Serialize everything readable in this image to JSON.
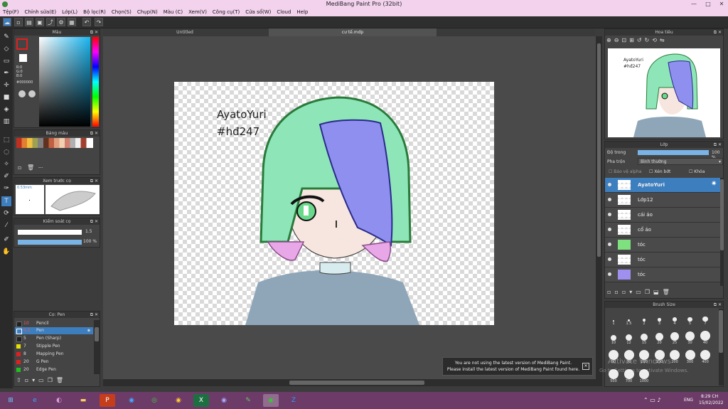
{
  "window": {
    "title": "MediBang Paint Pro (32bit)"
  },
  "menu": [
    "Tệp(F)",
    "Chỉnh sửa(E)",
    "Lớp(L)",
    "Bộ lọc(R)",
    "Chọn(S)",
    "Chụp(N)",
    "Màu (C)",
    "Xem(V)",
    "Công cụ(T)",
    "Cửa sổ(W)",
    "Cloud",
    "Help"
  ],
  "tabs": [
    "Untitled",
    "cư tế.mdp"
  ],
  "color_panel": {
    "title": "Màu",
    "r": "R:0",
    "g": "G:0",
    "b": "B:0",
    "hex": "#000000",
    "fg": "#000000"
  },
  "palette_panel": {
    "title": "Bảng màu",
    "more": "---"
  },
  "brush_preview": {
    "title": "Xem trước cọ",
    "size": "0.53mm"
  },
  "brush_control": {
    "title": "Kiểm soát cọ",
    "size_val": "1.5",
    "opacity_val": "100 %",
    "opacity": 1.0
  },
  "brush_list": {
    "title": "Cọ: Pen",
    "items": [
      {
        "num": "10",
        "name": "Pencil",
        "color": "#222222"
      },
      {
        "num": "0.5",
        "name": "Pen",
        "color": "#3d7ebf"
      },
      {
        "num": "5",
        "name": "Pen (Sharp)",
        "color": "#222222"
      },
      {
        "num": "7",
        "name": "Stipple Pen",
        "color": "#e8e000"
      },
      {
        "num": "8",
        "name": "Mapping Pen",
        "color": "#e02020"
      },
      {
        "num": "20",
        "name": "G Pen",
        "color": "#e02020"
      },
      {
        "num": "20",
        "name": "Edge Pen",
        "color": "#20c020"
      }
    ]
  },
  "canvas": {
    "line1": "AyatoYuri",
    "line2": "#hđ247"
  },
  "navigator": {
    "title": "Hoa tiêu",
    "line1": "AyatoYuri",
    "line2": "#hđ247"
  },
  "layer_panel": {
    "title": "Lớp",
    "opacity_label": "Độ trong",
    "opacity_val": "100 %",
    "opacity": 1.0,
    "blend_label": "Pha trộn",
    "blend_val": "Bình thường",
    "protect_alpha": "Bảo vệ alpha",
    "clip": "Xén bớt",
    "lock": "Khóa",
    "layers": [
      "AyatoYuri",
      "Lớp12",
      "cái áo",
      "cổ áo",
      "tóc",
      "tóc",
      "tóc"
    ]
  },
  "brush_size": {
    "title": "Brush Size",
    "sizes": [
      "1",
      "1.5",
      "2",
      "3",
      "4",
      "5",
      "7",
      "10",
      "12",
      "15",
      "20",
      "25",
      "30",
      "40",
      "50",
      "70",
      "100",
      "150",
      "200",
      "300",
      "400",
      "500",
      "700",
      "1000"
    ]
  },
  "notice": {
    "line1": "You are not using the latest version of MediBang Paint.",
    "line2": "Please install the latest version of MediBang Paint found here."
  },
  "watermark": {
    "line1": "Activate Windows",
    "line2": "Go to Settings to activate Windows."
  },
  "taskbar": {
    "lang": "ENG",
    "time": "8:29 CH",
    "date": "15/02/2022"
  }
}
